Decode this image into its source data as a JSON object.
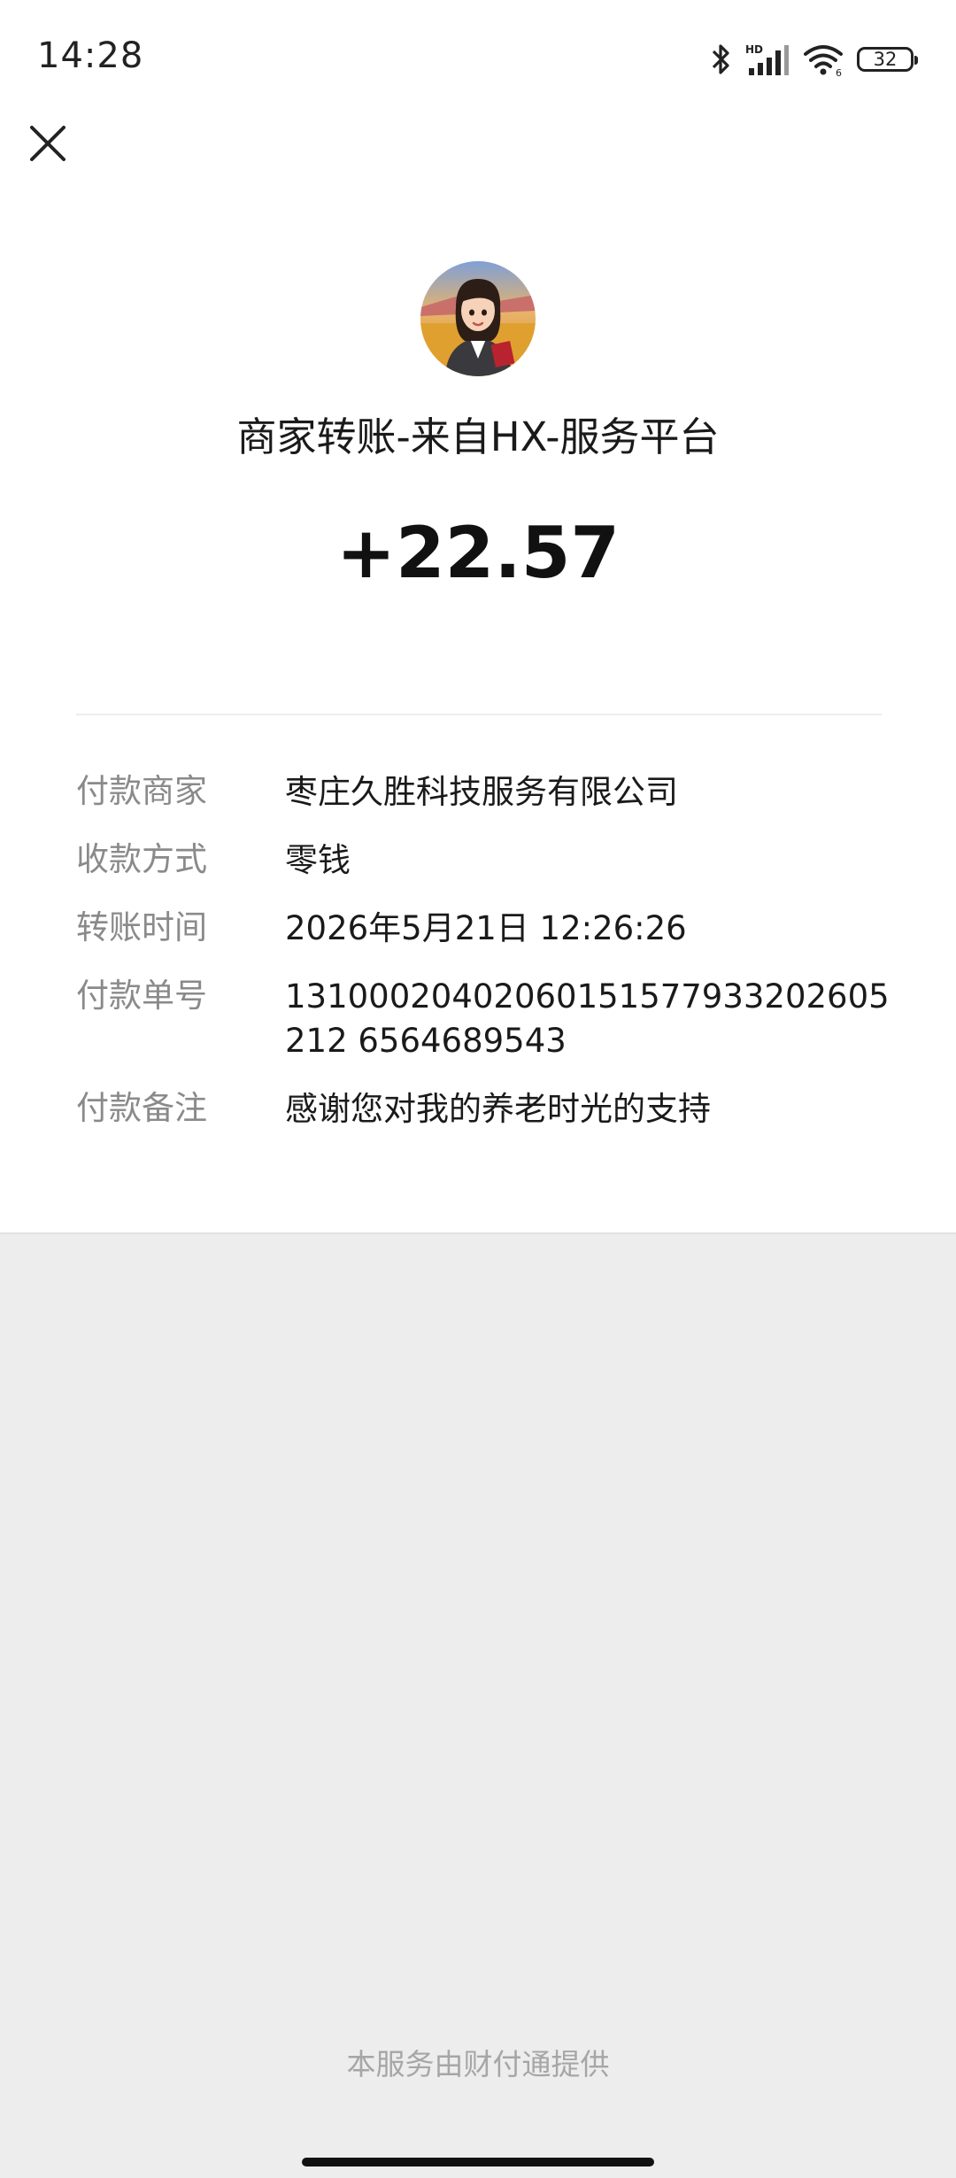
{
  "status_bar": {
    "time": "14:28",
    "battery_level": "32",
    "icons": [
      "bluetooth-icon",
      "hd-signal-icon",
      "wifi-icon",
      "battery-icon"
    ]
  },
  "header": {
    "close_icon": "close-icon"
  },
  "merchant": {
    "avatar_icon": "merchant-avatar",
    "title": "商家转账-来自HX-服务平台"
  },
  "amount": "+22.57",
  "details": [
    {
      "label": "付款商家",
      "value": "枣庄久胜科技服务有限公司"
    },
    {
      "label": "收款方式",
      "value": "零钱"
    },
    {
      "label": "转账时间",
      "value": "2026年5月21日 12:26:26"
    },
    {
      "label": "付款单号",
      "value": "13100020402060151577933202605212 6564689543"
    },
    {
      "label": "付款备注",
      "value": "感谢您对我的养老时光的支持"
    }
  ],
  "footer": "本服务由财付通提供"
}
